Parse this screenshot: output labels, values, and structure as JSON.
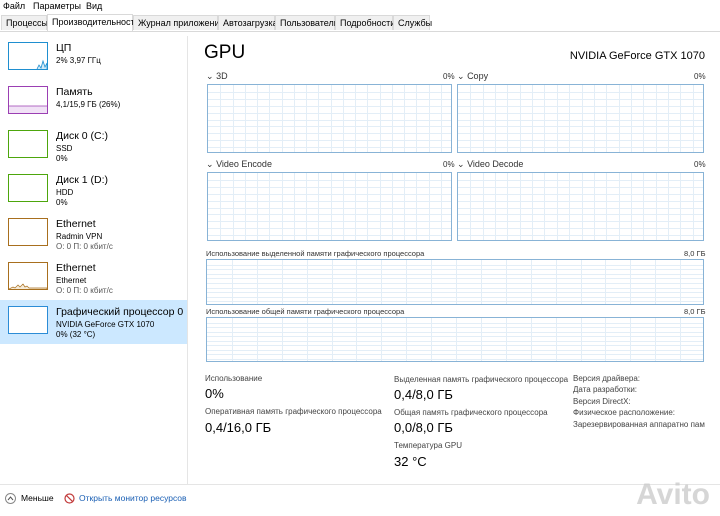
{
  "menu": [
    "Файл",
    "Параметры",
    "Вид"
  ],
  "tabs": [
    "Процессы",
    "Производительность",
    "Журнал приложений",
    "Автозагрузка",
    "Пользователи",
    "Подробности",
    "Службы"
  ],
  "sidebar": {
    "items": [
      {
        "name": "ЦП",
        "sub1": "2% 3,97 ГГц",
        "sub2": "",
        "color": "#1f8fd0"
      },
      {
        "name": "Память",
        "sub1": "4,1/15,9 ГБ (26%)",
        "sub2": "",
        "color": "#9b3fb3"
      },
      {
        "name": "Диск 0 (C:)",
        "sub1": "SSD",
        "sub2": "0%",
        "color": "#4da60c"
      },
      {
        "name": "Диск 1 (D:)",
        "sub1": "HDD",
        "sub2": "0%",
        "color": "#4da60c"
      },
      {
        "name": "Ethernet",
        "sub1": "Radmin VPN",
        "sub2": "О: 0 П: 0 кбит/с",
        "color": "#a86f1e"
      },
      {
        "name": "Ethernet",
        "sub1": "Ethernet",
        "sub2": "О: 0 П: 0 кбит/с",
        "color": "#a86f1e"
      },
      {
        "name": "Графический процессор 0",
        "sub1": "NVIDIA GeForce GTX 1070",
        "sub2": "0% (32 °C)",
        "color": "#2b8cd6"
      }
    ]
  },
  "main": {
    "title": "GPU",
    "model": "NVIDIA GeForce GTX 1070",
    "graphs": [
      {
        "label": "3D",
        "pct": "0%"
      },
      {
        "label": "Copy",
        "pct": "0%"
      },
      {
        "label": "Video Encode",
        "pct": "0%"
      },
      {
        "label": "Video Decode",
        "pct": "0%"
      }
    ],
    "dedicated_label": "Использование выделенной памяти графического процессора",
    "dedicated_max": "8,0 ГБ",
    "shared_label": "Использование общей памяти графического процессора",
    "shared_max": "8,0 ГБ",
    "stats": {
      "usage_label": "Использование",
      "usage_value": "0%",
      "ram_label": "Оперативная память графического процессора",
      "ram_value": "0,4/16,0 ГБ",
      "ded_label": "Выделенная память графического процессора",
      "ded_value": "0,4/8,0 ГБ",
      "shared_label": "Общая память графического процессора",
      "shared_value": "0,0/8,0 ГБ",
      "temp_label": "Температура GPU",
      "temp_value": "32 °C"
    },
    "info": [
      "Версия драйвера:",
      "Дата разработки:",
      "Версия DirectX:",
      "Физическое расположение:",
      "Зарезервированная аппаратно пам"
    ]
  },
  "footer": {
    "less": "Меньше",
    "monitor": "Открыть монитор ресурсов"
  },
  "watermark": "Avito"
}
